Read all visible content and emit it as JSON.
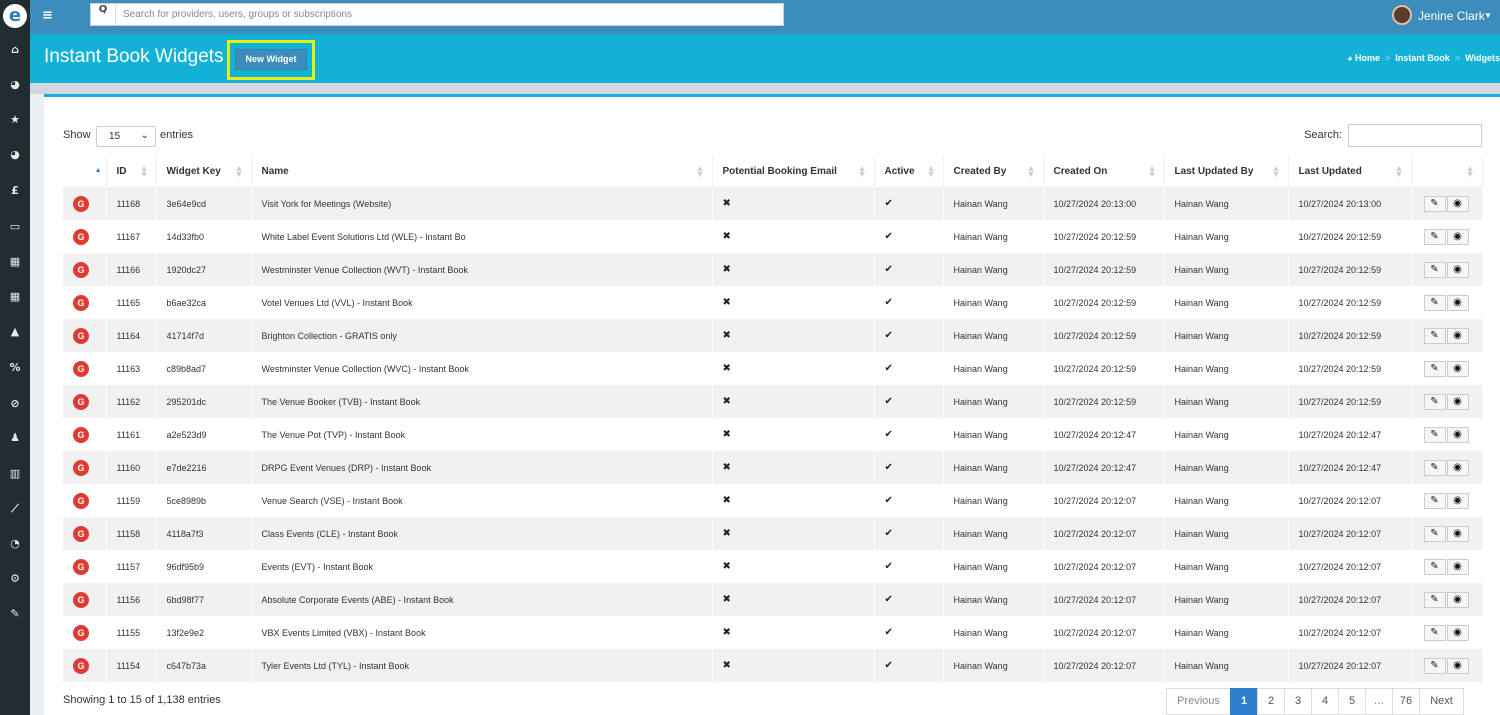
{
  "app": {
    "search_placeholder": "Search for providers, users, groups or subscriptions",
    "user_name": "Jenine Clark",
    "logo_letter": "e"
  },
  "sidebar": {
    "icons": [
      "home-icon",
      "dashboard-icon",
      "star-icon",
      "tachometer-icon",
      "pound-icon",
      "briefcase-icon",
      "calendar-icon",
      "calendar-grid-icon",
      "warning-icon",
      "percent-icon",
      "ban-icon",
      "user-icon",
      "bar-chart-icon",
      "line-chart-icon",
      "pie-chart-icon",
      "cogs-icon",
      "pencil-icon"
    ],
    "glyphs": [
      "⌂",
      "◕",
      "★",
      "◕",
      "£",
      "▭",
      "▦",
      "▦",
      "▲",
      "%",
      "⊘",
      "♟",
      "▥",
      "⟋",
      "◔",
      "⚙",
      "✎"
    ]
  },
  "header": {
    "title": "Instant Book Widgets",
    "new_widget_label": "New Widget",
    "breadcrumb": [
      "Home",
      "Instant Book",
      "Widgets"
    ],
    "breadcrumb_sep": ">"
  },
  "table_controls": {
    "show_label": "Show",
    "entries_label": "entries",
    "page_length": "15",
    "search_label": "Search:"
  },
  "table": {
    "columns": [
      "",
      "ID",
      "Widget Key",
      "Name",
      "Potential Booking Email",
      "Active",
      "Created By",
      "Created On",
      "Last Updated By",
      "Last Updated",
      ""
    ],
    "badge_letter": "G",
    "cross": "✖",
    "check": "✔",
    "rows": [
      {
        "id": "11168",
        "key": "3e64e9cd",
        "name": "Visit York for Meetings (Website)",
        "created_by": "Hainan Wang",
        "created_on": "10/27/2024 20:13:00",
        "updated_by": "Hainan Wang",
        "updated": "10/27/2024 20:13:00"
      },
      {
        "id": "11167",
        "key": "14d33fb0",
        "name": "White Label Event Solutions Ltd (WLE) - Instant Bo",
        "created_by": "Hainan Wang",
        "created_on": "10/27/2024 20:12:59",
        "updated_by": "Hainan Wang",
        "updated": "10/27/2024 20:12:59"
      },
      {
        "id": "11166",
        "key": "1920dc27",
        "name": "Westminster Venue Collection (WVT) - Instant Book",
        "created_by": "Hainan Wang",
        "created_on": "10/27/2024 20:12:59",
        "updated_by": "Hainan Wang",
        "updated": "10/27/2024 20:12:59"
      },
      {
        "id": "11165",
        "key": "b6ae32ca",
        "name": "Votel Venues Ltd (VVL) - Instant Book",
        "created_by": "Hainan Wang",
        "created_on": "10/27/2024 20:12:59",
        "updated_by": "Hainan Wang",
        "updated": "10/27/2024 20:12:59"
      },
      {
        "id": "11164",
        "key": "41714f7d",
        "name": "Brighton Collection - GRATIS only",
        "created_by": "Hainan Wang",
        "created_on": "10/27/2024 20:12:59",
        "updated_by": "Hainan Wang",
        "updated": "10/27/2024 20:12:59"
      },
      {
        "id": "11163",
        "key": "c89b8ad7",
        "name": "Westminster Venue Collection (WVC) - Instant Book",
        "created_by": "Hainan Wang",
        "created_on": "10/27/2024 20:12:59",
        "updated_by": "Hainan Wang",
        "updated": "10/27/2024 20:12:59"
      },
      {
        "id": "11162",
        "key": "295201dc",
        "name": "The Venue Booker (TVB) - Instant Book",
        "created_by": "Hainan Wang",
        "created_on": "10/27/2024 20:12:59",
        "updated_by": "Hainan Wang",
        "updated": "10/27/2024 20:12:59"
      },
      {
        "id": "11161",
        "key": "a2e523d9",
        "name": "The Venue Pot (TVP) - Instant Book",
        "created_by": "Hainan Wang",
        "created_on": "10/27/2024 20:12:47",
        "updated_by": "Hainan Wang",
        "updated": "10/27/2024 20:12:47"
      },
      {
        "id": "11160",
        "key": "e7de2216",
        "name": "DRPG Event Venues (DRP) - Instant Book",
        "created_by": "Hainan Wang",
        "created_on": "10/27/2024 20:12:47",
        "updated_by": "Hainan Wang",
        "updated": "10/27/2024 20:12:47"
      },
      {
        "id": "11159",
        "key": "5ce8989b",
        "name": "Venue Search (VSE) - Instant Book",
        "created_by": "Hainan Wang",
        "created_on": "10/27/2024 20:12:07",
        "updated_by": "Hainan Wang",
        "updated": "10/27/2024 20:12:07"
      },
      {
        "id": "11158",
        "key": "4118a7f3",
        "name": "Class Events (CLE) - Instant Book",
        "created_by": "Hainan Wang",
        "created_on": "10/27/2024 20:12:07",
        "updated_by": "Hainan Wang",
        "updated": "10/27/2024 20:12:07"
      },
      {
        "id": "11157",
        "key": "96df95b9",
        "name": "Events (EVT) - Instant Book",
        "created_by": "Hainan Wang",
        "created_on": "10/27/2024 20:12:07",
        "updated_by": "Hainan Wang",
        "updated": "10/27/2024 20:12:07"
      },
      {
        "id": "11156",
        "key": "6bd98f77",
        "name": "Absolute Corporate Events (ABE) - Instant Book",
        "created_by": "Hainan Wang",
        "created_on": "10/27/2024 20:12:07",
        "updated_by": "Hainan Wang",
        "updated": "10/27/2024 20:12:07"
      },
      {
        "id": "11155",
        "key": "13f2e9e2",
        "name": "VBX Events Limited (VBX) - Instant Book",
        "created_by": "Hainan Wang",
        "created_on": "10/27/2024 20:12:07",
        "updated_by": "Hainan Wang",
        "updated": "10/27/2024 20:12:07"
      },
      {
        "id": "11154",
        "key": "c647b73a",
        "name": "Tyler Events Ltd (TYL) - Instant Book",
        "created_by": "Hainan Wang",
        "created_on": "10/27/2024 20:12:07",
        "updated_by": "Hainan Wang",
        "updated": "10/27/2024 20:12:07"
      }
    ]
  },
  "footer": {
    "info": "Showing 1 to 15 of 1,138 entries",
    "pagination": [
      "Previous",
      "1",
      "2",
      "3",
      "4",
      "5",
      "…",
      "76",
      "Next"
    ],
    "active_page": "1"
  },
  "colors": {
    "topbar": "#3c8dbc",
    "header_band": "#14b1d7",
    "sidebar": "#222d32",
    "highlight": "#e8ee13",
    "badge": "#e03b32",
    "active_page": "#2c7fcf"
  }
}
